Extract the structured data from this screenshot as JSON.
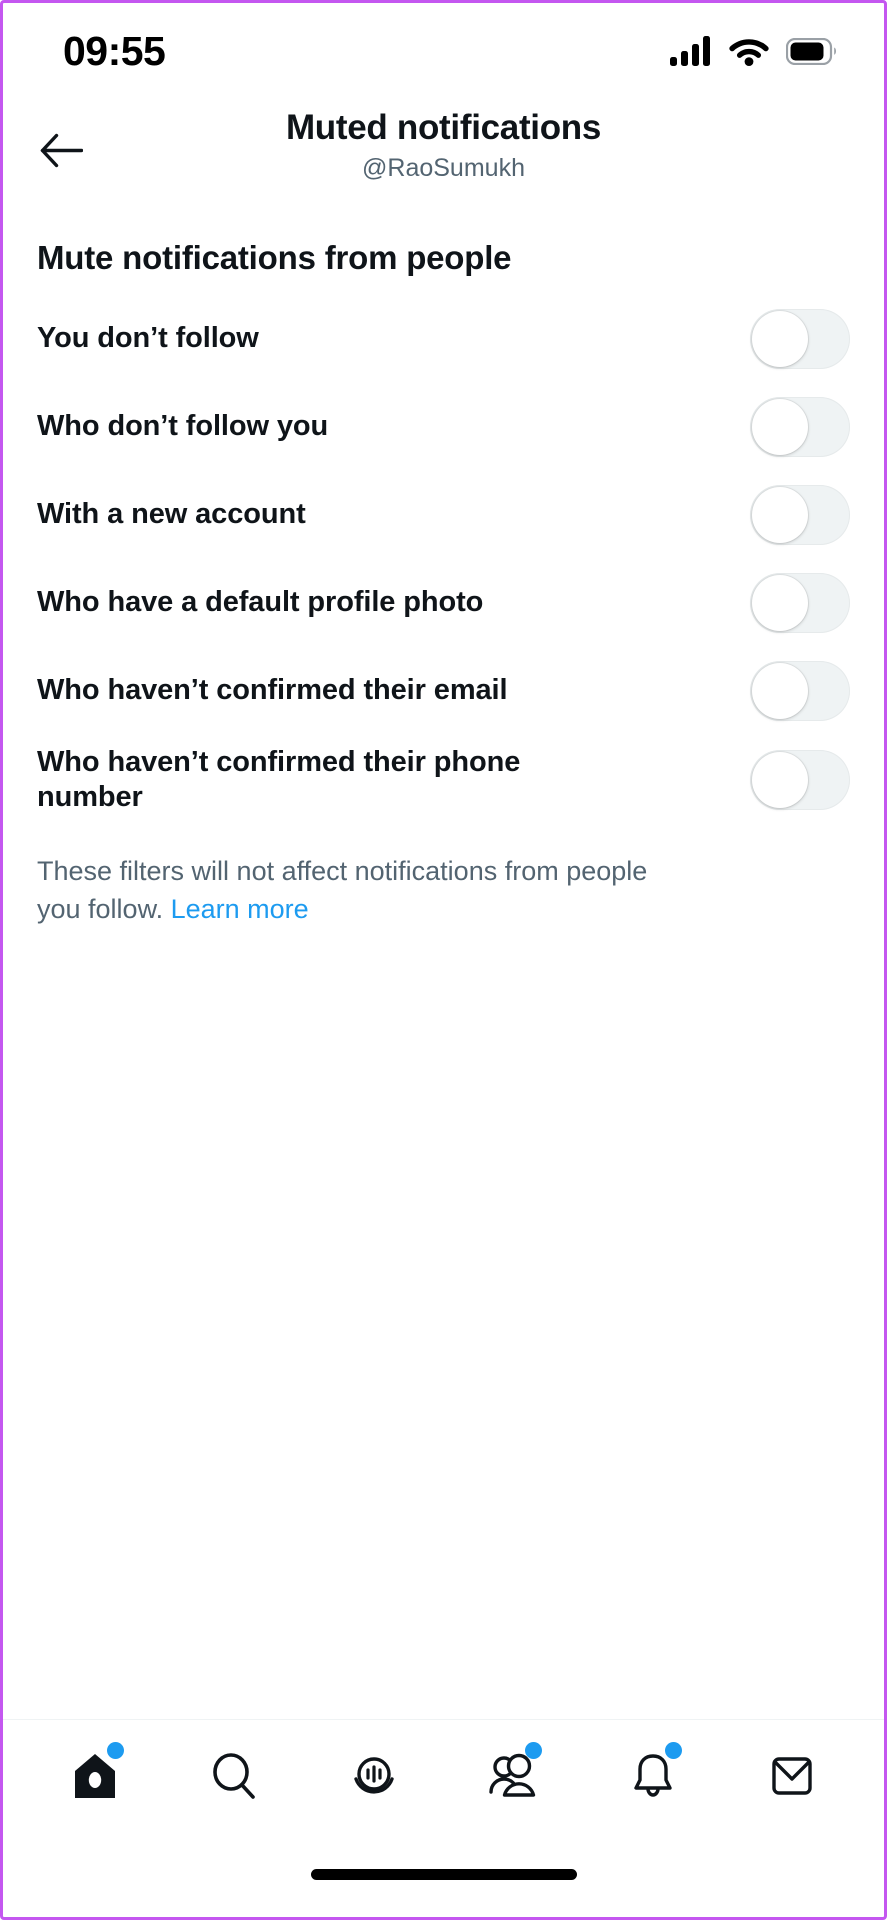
{
  "status_bar": {
    "time": "09:55",
    "icons": [
      "cellular-signal-icon",
      "wifi-icon",
      "battery-icon"
    ],
    "battery_level": 78
  },
  "header": {
    "back_icon": "back-arrow-icon",
    "title": "Muted notifications",
    "subtitle": "@RaoSumukh"
  },
  "main": {
    "section_heading": "Mute notifications from people",
    "rows": [
      {
        "label": "You don’t follow",
        "state": "off"
      },
      {
        "label": "Who don’t follow you",
        "state": "off"
      },
      {
        "label": "With a new account",
        "state": "off"
      },
      {
        "label": "Who have a default profile photo",
        "state": "off"
      },
      {
        "label": "Who haven’t confirmed their email",
        "state": "off"
      },
      {
        "label": "Who haven’t confirmed their phone number",
        "state": "off"
      }
    ],
    "disclaimer_text": "These filters will not affect notifications from people you follow. ",
    "disclaimer_link": "Learn more"
  },
  "bottom_nav": {
    "items": [
      {
        "name": "home",
        "icon": "home-icon",
        "badge": true
      },
      {
        "name": "search",
        "icon": "search-icon",
        "badge": false
      },
      {
        "name": "spaces",
        "icon": "spaces-icon",
        "badge": false
      },
      {
        "name": "communities",
        "icon": "communities-icon",
        "badge": true
      },
      {
        "name": "notifications",
        "icon": "bell-icon",
        "badge": true
      },
      {
        "name": "messages",
        "icon": "envelope-icon",
        "badge": false
      }
    ]
  },
  "colors": {
    "accent_blue": "#1d9bf0",
    "text_primary": "#0f1419",
    "text_secondary": "#536471",
    "switch_off_track": "#eff3f4",
    "device_frame": "#c457f0"
  }
}
